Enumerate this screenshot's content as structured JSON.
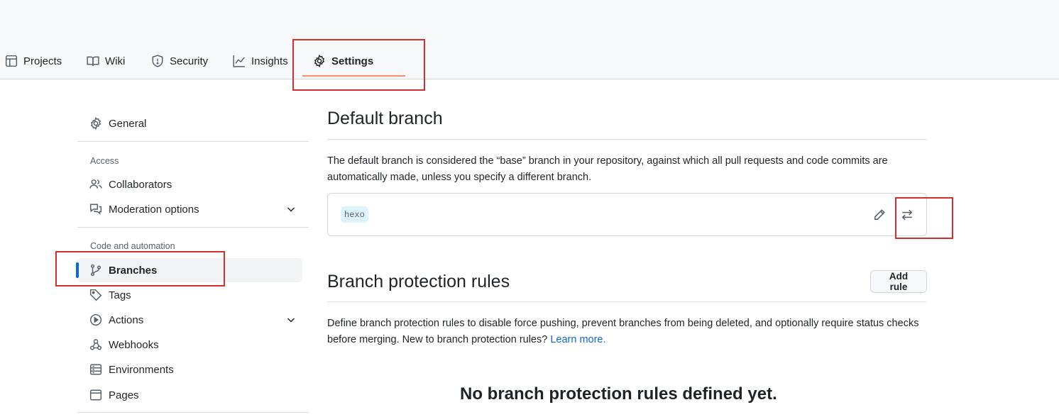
{
  "tabs": [
    {
      "label": "Projects",
      "icon": "table-icon"
    },
    {
      "label": "Wiki",
      "icon": "book-icon"
    },
    {
      "label": "Security",
      "icon": "shield-icon"
    },
    {
      "label": "Insights",
      "icon": "graph-icon"
    },
    {
      "label": "Settings",
      "icon": "gear-icon",
      "active": true
    }
  ],
  "sidebar": {
    "general": "General",
    "access_label": "Access",
    "collaborators": "Collaborators",
    "moderation": "Moderation options",
    "code_label": "Code and automation",
    "branches": "Branches",
    "tags": "Tags",
    "actions": "Actions",
    "webhooks": "Webhooks",
    "environments": "Environments",
    "pages": "Pages"
  },
  "main": {
    "default_branch": {
      "title": "Default branch",
      "description": "The default branch is considered the “base” branch in your repository, against which all pull requests and code commits are automatically made, unless you specify a different branch.",
      "branch_name": "hexo"
    },
    "protection": {
      "title": "Branch protection rules",
      "add_rule": "Add rule",
      "description": "Define branch protection rules to disable force pushing, prevent branches from being deleted, and optionally require status checks before merging. New to branch protection rules?",
      "learn_more": "Learn more.",
      "empty_title": "No branch protection rules defined yet."
    }
  },
  "colors": {
    "accent": "#0969da",
    "tab_underline": "#fd8c73",
    "annotation": "#d32f2f"
  }
}
